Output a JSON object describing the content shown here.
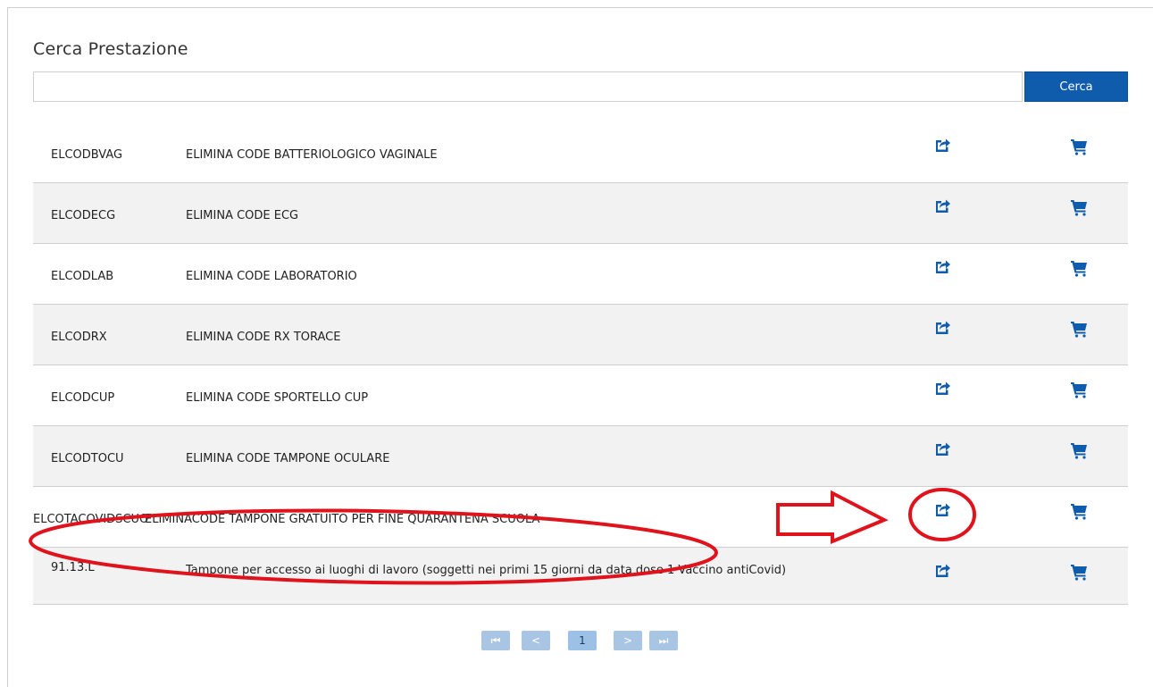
{
  "page": {
    "title": "Cerca Prestazione",
    "search_button": "Cerca",
    "search_value": ""
  },
  "rows": [
    {
      "code": "ELCODBVAG",
      "desc": "ELIMINA CODE BATTERIOLOGICO VAGINALE"
    },
    {
      "code": "ELCODECG",
      "desc": "ELIMINA CODE ECG"
    },
    {
      "code": "ELCODLAB",
      "desc": "ELIMINA CODE LABORATORIO"
    },
    {
      "code": "ELCODRX",
      "desc": "ELIMINA CODE RX TORACE"
    },
    {
      "code": "ELCODCUP",
      "desc": "ELIMINA CODE SPORTELLO CUP"
    },
    {
      "code": "ELCODTOCU",
      "desc": "ELIMINA CODE TAMPONE OCULARE"
    },
    {
      "code": "ELCOTACOVIDSCUO",
      "desc": "ELIMINACODE TAMPONE GRATUITO PER FINE QUARANTENA SCUOLA"
    },
    {
      "code": "91.13.L",
      "desc": "Tampone per accesso ai luoghi di lavoro (soggetti nei primi 15 giorni da data dose 1 Vaccino antiCovid)"
    }
  ],
  "pager": {
    "first": "⏮",
    "prev": "<",
    "current": "1",
    "next": ">",
    "last": "⏭"
  },
  "icons": {
    "share": "share-icon",
    "cart": "cart-icon"
  },
  "colors": {
    "primary": "#0f5cad",
    "annotation": "#e0131c",
    "row_alt": "#f2f2f2"
  }
}
